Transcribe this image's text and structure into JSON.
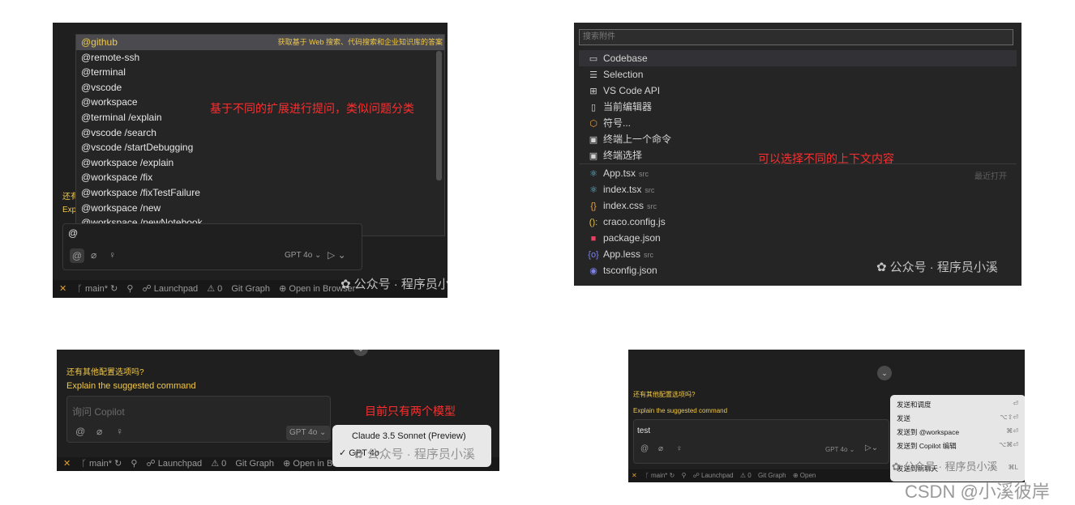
{
  "p1": {
    "items": [
      "@github",
      "@remote-ssh",
      "@terminal",
      "@vscode",
      "@workspace",
      "@terminal /explain",
      "@vscode /search",
      "@vscode /startDebugging",
      "@workspace /explain",
      "@workspace /fix",
      "@workspace /fixTestFailure",
      "@workspace /new",
      "@workspace /newNotebook"
    ],
    "github_desc": "获取基于 Web 搜索、代码搜索和企业知识库的答案",
    "note": "基于不同的扩展进行提问，类似问题分类",
    "left_cut_1": "还有",
    "left_cut_2": "Exp",
    "input_value": "@",
    "model": "GPT 4o",
    "status": {
      "branch": "main*",
      "launchpad": "Launchpad",
      "count": "0",
      "git_graph": "Git Graph",
      "open_browser": "Open in Browser"
    },
    "watermark": "公众号 · 程序员小溪"
  },
  "p2": {
    "search_placeholder": "搜索附件",
    "context_items": [
      {
        "icon": "folder",
        "label": "Codebase"
      },
      {
        "icon": "lines",
        "label": "Selection"
      },
      {
        "icon": "api",
        "label": "VS Code API"
      },
      {
        "icon": "file",
        "label": "当前编辑器"
      },
      {
        "icon": "cube",
        "label": "符号..."
      },
      {
        "icon": "terminal",
        "label": "终端上一个命令"
      },
      {
        "icon": "terminal",
        "label": "终端选择"
      }
    ],
    "files": [
      {
        "icon": "react",
        "name": "App.tsx",
        "dir": "src"
      },
      {
        "icon": "react",
        "name": "index.tsx",
        "dir": "src"
      },
      {
        "icon": "braces",
        "name": "index.css",
        "dir": "src"
      },
      {
        "icon": "braces",
        "name": "craco.config.js",
        "dir": ""
      },
      {
        "icon": "npm",
        "name": "package.json",
        "dir": ""
      },
      {
        "icon": "less",
        "name": "App.less",
        "dir": "src"
      },
      {
        "icon": "ts",
        "name": "tsconfig.json",
        "dir": ""
      }
    ],
    "recent_label": "最近打开",
    "note": "可以选择不同的上下文内容",
    "watermark": "公众号 · 程序员小溪"
  },
  "p3": {
    "question": "还有其他配置选项吗?",
    "suggestion": "Explain the suggested command",
    "input_placeholder": "询问 Copilot",
    "model": "GPT 4o",
    "note": "目前只有两个模型",
    "models": [
      "Claude 3.5 Sonnet (Preview)",
      "GPT 4o"
    ],
    "selected_model": "GPT 4o",
    "status": {
      "branch": "main*",
      "launchpad": "Launchpad",
      "count": "0",
      "git_graph": "Git Graph",
      "open_browser": "Open in Browser"
    },
    "watermark": "公众号 · 程序员小溪"
  },
  "p4": {
    "question": "还有其他配置选项吗?",
    "suggestion": "Explain the suggested command",
    "input_value": "test",
    "model": "GPT 4o",
    "send_options": [
      {
        "label": "发送和调度",
        "shortcut": "⏎"
      },
      {
        "label": "发送",
        "shortcut": "⌥⇧⏎"
      },
      {
        "label": "发送到 @workspace",
        "shortcut": "⌘⏎"
      },
      {
        "label": "发送到 Copilot 编辑",
        "shortcut": "⌥⌘⏎"
      },
      {
        "label": "发送到新聊天",
        "shortcut": "⌘L"
      }
    ],
    "status": {
      "branch": "main*",
      "launchpad": "Launchpad",
      "count": "0",
      "git_graph": "Git Graph",
      "open_browser": "Open"
    },
    "watermark": "公众号 · 程序员小溪"
  },
  "credit": "CSDN @小溪彼岸"
}
